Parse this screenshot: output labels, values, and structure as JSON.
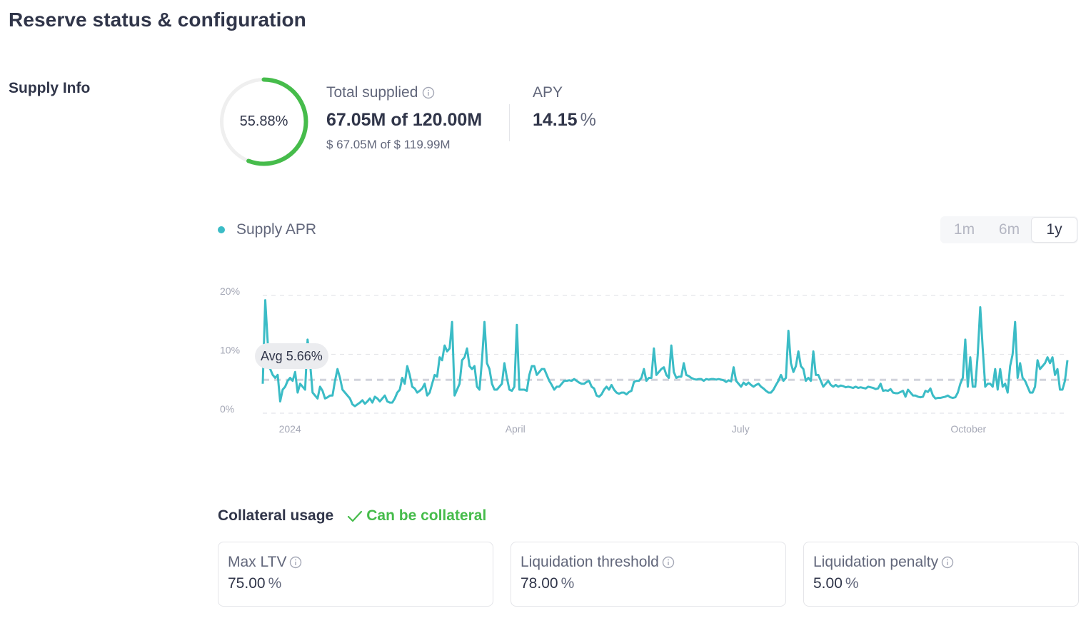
{
  "page": {
    "title": "Reserve status & configuration"
  },
  "supply_info": {
    "section_label": "Supply Info",
    "utilization_percent": 55.88,
    "utilization_label": "55.88%",
    "total_supplied": {
      "title": "Total supplied",
      "main": "67.05M of 120.00M",
      "sub": "$ 67.05M of $ 119.99M",
      "icon": "info-icon"
    },
    "apy": {
      "title": "APY",
      "value": "14.15",
      "unit": "%"
    }
  },
  "chart_controls": {
    "legend_label": "Supply APR",
    "ranges": [
      "1m",
      "6m",
      "1y"
    ],
    "selected_range": "1y",
    "avg_label": "Avg 5.66%"
  },
  "colors": {
    "series": "#3bbcc6",
    "ring_fill": "#46bc4b",
    "ring_track": "#efefef",
    "success": "#46bc4b",
    "avg_line": "#d2d4dc",
    "grid": "#e4e5e9"
  },
  "chart_data": {
    "type": "line",
    "title": "",
    "xlabel": "",
    "ylabel": "",
    "legend": "top-left",
    "grid": true,
    "ylim": [
      0,
      20
    ],
    "yticks": [
      "0%",
      "10%",
      "20%"
    ],
    "ytick_values": [
      0,
      10,
      20
    ],
    "xticks": [
      "2024",
      "April",
      "July",
      "October"
    ],
    "xtick_days": [
      11,
      102,
      193,
      285
    ],
    "x_start": "2023-12-21",
    "x_unit": "day",
    "average": 5.66,
    "series": [
      {
        "name": "Supply APR",
        "values": [
          5.0,
          19.2,
          12.0,
          7.5,
          6.5,
          6.0,
          6.5,
          2.0,
          4.0,
          4.5,
          5.5,
          6.0,
          5.5,
          7.0,
          3.5,
          5.0,
          4.5,
          4.0,
          12.5,
          8.5,
          3.5,
          3.0,
          2.5,
          4.5,
          3.8,
          2.5,
          2.7,
          3.0,
          3.0,
          5.5,
          7.5,
          6.0,
          4.0,
          3.5,
          3.0,
          2.5,
          1.5,
          1.2,
          1.5,
          1.8,
          2.2,
          1.6,
          2.0,
          2.5,
          1.8,
          2.8,
          2.5,
          2.0,
          2.5,
          3.0,
          2.0,
          1.8,
          1.8,
          2.5,
          3.5,
          4.0,
          6.0,
          5.0,
          8.0,
          6.5,
          4.5,
          4.2,
          3.5,
          3.8,
          4.2,
          5.0,
          3.0,
          3.5,
          5.0,
          6.5,
          6.2,
          9.5,
          9.0,
          11.5,
          10.5,
          11.0,
          15.5,
          3.0,
          4.0,
          5.0,
          9.0,
          9.5,
          11.0,
          8.0,
          7.5,
          8.0,
          4.5,
          4.0,
          9.0,
          15.5,
          8.5,
          7.5,
          5.0,
          4.0,
          4.0,
          4.5,
          5.0,
          8.5,
          6.0,
          4.0,
          3.8,
          4.5,
          15.0,
          4.0,
          4.0,
          4.0,
          3.8,
          6.5,
          8.0,
          8.0,
          6.5,
          7.0,
          7.5,
          7.5,
          6.5,
          5.5,
          4.8,
          4.0,
          4.5,
          4.5,
          5.0,
          5.5,
          5.5,
          5.6,
          5.5,
          5.8,
          5.5,
          5.2,
          5.0,
          5.0,
          5.3,
          5.5,
          4.5,
          4.2,
          3.0,
          2.8,
          3.2,
          4.0,
          4.5,
          4.0,
          4.8,
          4.0,
          3.5,
          3.3,
          3.5,
          3.5,
          3.2,
          3.6,
          3.8,
          5.3,
          5.5,
          5.5,
          6.0,
          7.5,
          5.5,
          6.0,
          6.0,
          11.0,
          6.5,
          7.0,
          7.5,
          7.8,
          6.5,
          6.0,
          11.5,
          7.0,
          6.0,
          6.2,
          6.2,
          8.5,
          6.5,
          6.3,
          6.0,
          5.8,
          5.7,
          5.8,
          5.8,
          5.5,
          5.8,
          5.7,
          5.8,
          5.8,
          5.7,
          5.8,
          5.7,
          5.6,
          5.3,
          5.6,
          5.4,
          7.8,
          5.5,
          5.0,
          4.5,
          5.2,
          4.8,
          5.2,
          4.8,
          4.5,
          4.8,
          5.0,
          4.5,
          4.2,
          3.8,
          3.5,
          3.5,
          4.0,
          4.8,
          5.5,
          6.5,
          5.5,
          6.0,
          14.0,
          8.5,
          7.0,
          8.0,
          10.5,
          8.0,
          7.5,
          5.5,
          6.0,
          5.5,
          10.5,
          6.5,
          6.5,
          5.5,
          4.5,
          5.0,
          5.5,
          4.8,
          4.5,
          4.8,
          4.5,
          4.7,
          4.6,
          4.4,
          4.5,
          4.4,
          4.3,
          4.5,
          4.3,
          4.4,
          4.3,
          4.2,
          4.5,
          4.4,
          4.3,
          4.1,
          4.2,
          5.0,
          3.8,
          3.9,
          3.8,
          4.1,
          3.5,
          3.4,
          3.4,
          3.6,
          3.8,
          2.8,
          4.0,
          3.5,
          3.0,
          3.0,
          2.8,
          2.7,
          2.8,
          3.8,
          3.6,
          4.2,
          3.0,
          2.5,
          2.6,
          2.6,
          2.7,
          2.8,
          3.0,
          2.7,
          2.6,
          2.7,
          3.5,
          5.0,
          6.0,
          12.5,
          4.5,
          9.5,
          4.5,
          4.5,
          10.0,
          18.0,
          11.0,
          4.5,
          5.0,
          5.0,
          4.5,
          7.5,
          4.0,
          7.5,
          4.5,
          5.0,
          3.5,
          8.0,
          10.0,
          15.5,
          6.0,
          8.5,
          6.0,
          5.5,
          4.5,
          3.5,
          3.5,
          4.5,
          9.0,
          7.5,
          8.0,
          8.5,
          9.5,
          8.5,
          9.5,
          6.5,
          7.5,
          4.0,
          4.0,
          5.5,
          9.0
        ]
      }
    ]
  },
  "collateral": {
    "title": "Collateral usage",
    "status": "Can be collateral",
    "cards": [
      {
        "label": "Max LTV",
        "value": "75.00",
        "unit": "%"
      },
      {
        "label": "Liquidation threshold",
        "value": "78.00",
        "unit": "%"
      },
      {
        "label": "Liquidation penalty",
        "value": "5.00",
        "unit": "%"
      }
    ]
  }
}
